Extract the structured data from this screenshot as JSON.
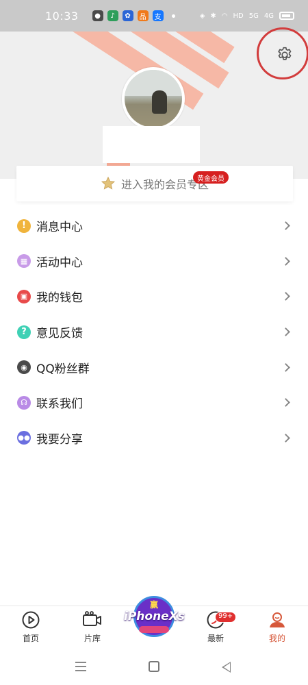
{
  "status_bar": {
    "time": "10:33",
    "signal_5g": "5G",
    "signal_4g": "4G",
    "hd": "HD",
    "app_icons": [
      {
        "name": "msg-app-icon",
        "color": "#4a4a4a",
        "glyph": "●"
      },
      {
        "name": "green-app-icon",
        "color": "#2e9e5b",
        "glyph": "♪"
      },
      {
        "name": "baidu-app-icon",
        "color": "#2a65d6",
        "glyph": "✿"
      },
      {
        "name": "orange-app-icon",
        "color": "#f07a1a",
        "glyph": "品"
      },
      {
        "name": "alipay-app-icon",
        "color": "#1677ff",
        "glyph": "支"
      }
    ]
  },
  "header": {
    "member_zone_label": "进入我的会员专区",
    "member_badge": "黄金会员"
  },
  "menu": {
    "items": [
      {
        "label": "消息中心",
        "icon": "alert-icon",
        "color": "#f0b43c",
        "glyph": "!"
      },
      {
        "label": "活动中心",
        "icon": "gift-icon",
        "color": "#c89be8",
        "glyph": "▦"
      },
      {
        "label": "我的钱包",
        "icon": "wallet-icon",
        "color": "#e84a4a",
        "glyph": "▣"
      },
      {
        "label": "意见反馈",
        "icon": "question-icon",
        "color": "#3fd1b5",
        "glyph": "?"
      },
      {
        "label": "QQ粉丝群",
        "icon": "qq-icon",
        "color": "#4a4a4a",
        "glyph": "◉"
      },
      {
        "label": "联系我们",
        "icon": "headset-icon",
        "color": "#b98ae6",
        "glyph": "☊"
      },
      {
        "label": "我要分享",
        "icon": "users-icon",
        "color": "#6b6fe0",
        "glyph": "●"
      }
    ]
  },
  "bottom_nav": {
    "items": [
      {
        "label": "首页",
        "icon": "play-circle-icon"
      },
      {
        "label": "片库",
        "icon": "video-camera-icon"
      },
      {
        "label": "最新",
        "icon": "flame-icon"
      },
      {
        "label": "我的",
        "icon": "user-icon"
      }
    ],
    "active_color": "#d6583a",
    "promo": {
      "top": "赢",
      "main": "iPhoneXs"
    },
    "new_badge": "99+"
  }
}
